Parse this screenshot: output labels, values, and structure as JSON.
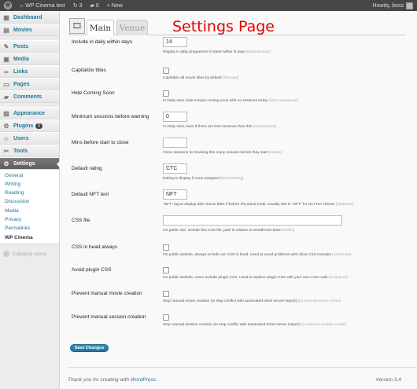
{
  "adminbar": {
    "site_name": "WP Cinema test",
    "updates_count": "3",
    "comments_count": "0",
    "new_label": "+ New",
    "howdy": "Howdy, boss"
  },
  "sidebar": {
    "items": [
      {
        "label": "Dashboard",
        "icon": "dashboard-icon"
      },
      {
        "label": "Movies",
        "icon": "movies-icon"
      },
      {
        "label": "Posts",
        "icon": "posts-icon"
      },
      {
        "label": "Media",
        "icon": "media-icon"
      },
      {
        "label": "Links",
        "icon": "links-icon"
      },
      {
        "label": "Pages",
        "icon": "pages-icon"
      },
      {
        "label": "Comments",
        "icon": "comments-icon"
      },
      {
        "label": "Appearance",
        "icon": "appearance-icon"
      },
      {
        "label": "Plugins",
        "icon": "plugins-icon",
        "badge": "1"
      },
      {
        "label": "Users",
        "icon": "users-icon"
      },
      {
        "label": "Tools",
        "icon": "tools-icon"
      },
      {
        "label": "Settings",
        "icon": "settings-icon"
      }
    ],
    "submenu": [
      "General",
      "Writing",
      "Reading",
      "Discussion",
      "Media",
      "Privacy",
      "Permalinks",
      "WP Cinema"
    ],
    "collapse": "Collapse menu"
  },
  "tabs": {
    "main": "Main",
    "venue": "Venue"
  },
  "page_title": "Settings Page",
  "settings": [
    {
      "label": "Include in daily within days",
      "type": "text",
      "value": "14",
      "desc": "Display in daily programme if starts within N days",
      "key": "[dailyforedays]"
    },
    {
      "label": "Capitalize titles",
      "type": "checkbox",
      "desc": "Capitalize all movie titles by default",
      "key": "[titlecaps]"
    },
    {
      "label": "Hide Coming Soon",
      "type": "checkbox",
      "desc": "In Daily view, hide movies coming soon with no sessions today",
      "key": "[hidecomingsoon]"
    },
    {
      "label": "Minimum sessions before warning",
      "type": "text",
      "value": "0",
      "desc": "In Daily view, warn if there are less sessions than this",
      "key": "[minsessions]"
    },
    {
      "label": "Mins before start to close",
      "type": "text",
      "value": "",
      "desc": "Close sessions for booking this many minutes before they start",
      "key": "[toolate]"
    },
    {
      "label": "Default rating",
      "type": "text",
      "value": "CTC",
      "desc": "Rating to display if none assigned",
      "key": "[defaultrating]"
    },
    {
      "label": "Default NFT text",
      "type": "text",
      "value": "NFT",
      "desc": "\"NFT\" tag to display after movie titles if before nft period ends. Usually this is \"NFT\" for No Free Tickets",
      "key": "[nftdefault]"
    },
    {
      "label": "CSS file",
      "type": "wide",
      "value": "",
      "desc": "On public site, include this CSS file, path is relative to WordPress base",
      "key": "[cssfile]"
    },
    {
      "label": "CSS in head always",
      "type": "checkbox",
      "desc": "On public website, always include our CSS in head. Used to avoid problems with inline CSS includes",
      "key": "[cssinhead]"
    },
    {
      "label": "Avoid plugin CSS",
      "type": "checkbox",
      "desc": "On public website, never include plugin CSS. Used to replace plugin CSS with your own CSS code",
      "key": "[avoidpcss]"
    },
    {
      "label": "Prevent manual movie creation",
      "type": "checkbox",
      "desc": "Stop manual movie creation (to stop conflict with automated ticket server import)",
      "key": "[no-manual-movie-create]"
    },
    {
      "label": "Prevent manual session creation",
      "type": "checkbox",
      "desc": "Stop manual session creation (to stop conflict with automated ticket server import)",
      "key": "[no-manual-session-create]"
    }
  ],
  "save_label": "Save Changes",
  "footer": {
    "text": "Thank you for creating with ",
    "link": "WordPress",
    "suffix": ".",
    "version": "Version 3.4"
  },
  "colors": {
    "accent": "#21759b",
    "title": "#e20000",
    "adminbar": "#464646"
  }
}
